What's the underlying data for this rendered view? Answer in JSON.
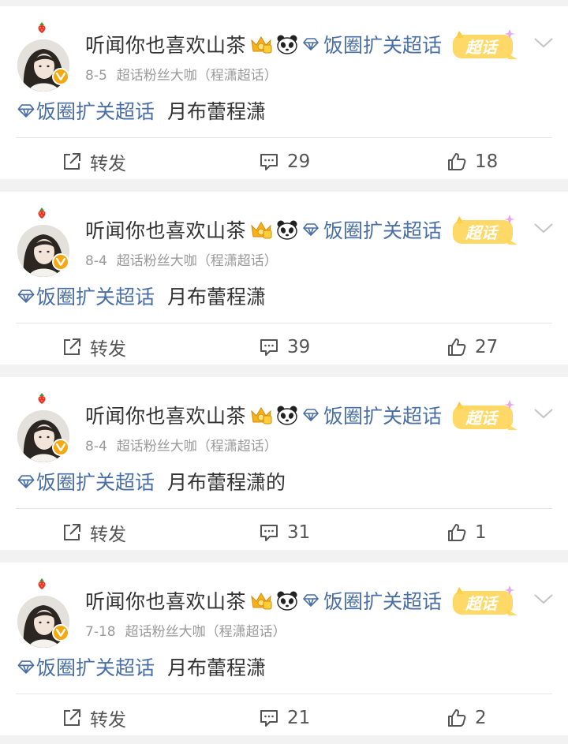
{
  "feed": [
    {
      "username": "听闻你也喜欢山茶",
      "super_topic": "饭圈扩关超话",
      "badge": "超话",
      "date": "8-5",
      "source": "超话粉丝大咖（程潇超话）",
      "topic_link": "饭圈扩关超话",
      "text": "月布蕾程潇",
      "share_label": "转发",
      "comments": "29",
      "likes": "18"
    },
    {
      "username": "听闻你也喜欢山茶",
      "super_topic": "饭圈扩关超话",
      "badge": "超话",
      "date": "8-4",
      "source": "超话粉丝大咖（程潇超话）",
      "topic_link": "饭圈扩关超话",
      "text": "月布蕾程潇",
      "share_label": "转发",
      "comments": "39",
      "likes": "27"
    },
    {
      "username": "听闻你也喜欢山茶",
      "super_topic": "饭圈扩关超话",
      "badge": "超话",
      "date": "8-4",
      "source": "超话粉丝大咖（程潇超话）",
      "topic_link": "饭圈扩关超话",
      "text": "月布蕾程潇的",
      "share_label": "转发",
      "comments": "31",
      "likes": "1"
    },
    {
      "username": "听闻你也喜欢山茶",
      "super_topic": "饭圈扩关超话",
      "badge": "超话",
      "date": "7-18",
      "source": "超话粉丝大咖（程潇超话）",
      "topic_link": "饭圈扩关超话",
      "text": "月布蕾程潇",
      "share_label": "转发",
      "comments": "21",
      "likes": "2"
    }
  ],
  "colors": {
    "link": "#4a6fa5",
    "badge": "#f7a80e",
    "background": "#f2f2f2"
  },
  "icons": [
    "strawberry-icon",
    "verified-badge-icon",
    "crown-icon",
    "panda-icon",
    "diamond-icon",
    "chaohua-badge-icon",
    "chevron-down-icon",
    "share-icon",
    "comment-icon",
    "like-icon"
  ]
}
